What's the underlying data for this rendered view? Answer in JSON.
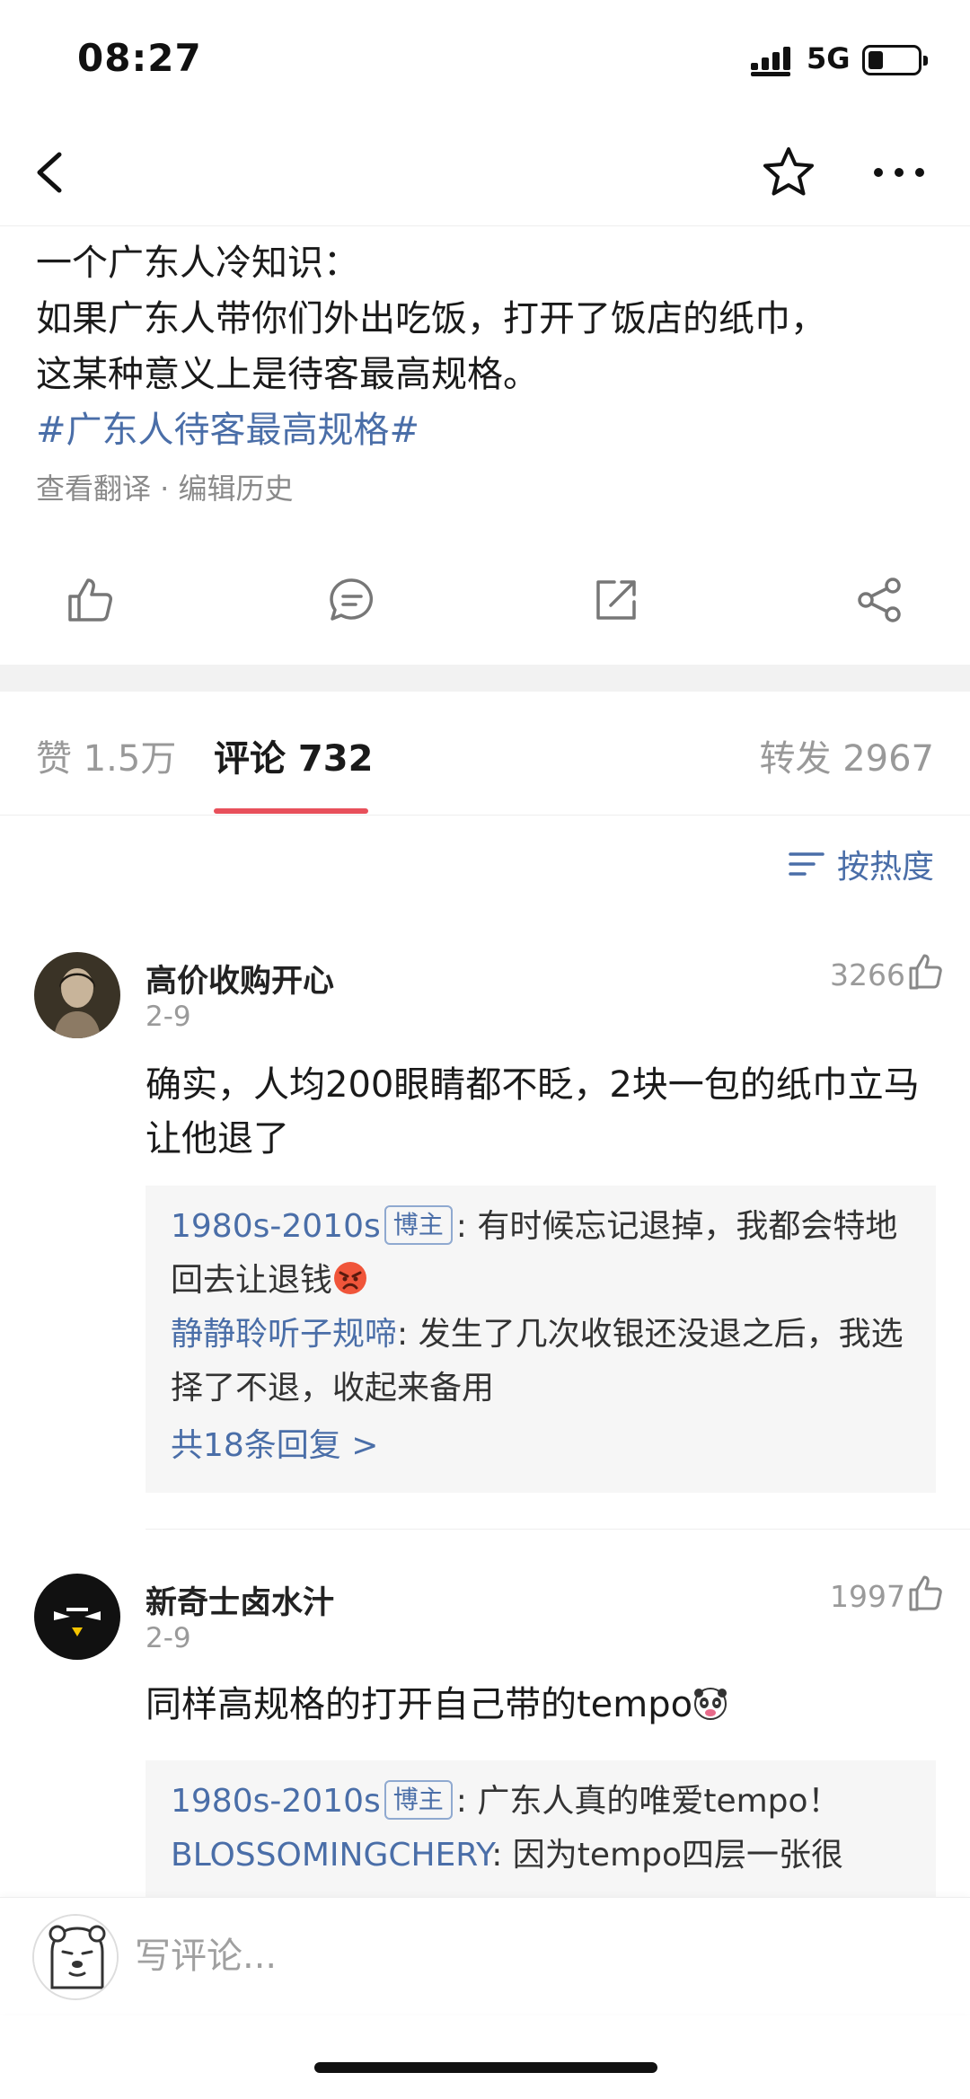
{
  "status": {
    "time": "08:27",
    "network": "5G"
  },
  "post": {
    "lines": [
      "一个广东人冷知识：",
      "如果广东人带你们外出吃饭，打开了饭店的纸巾，",
      "这某种意义上是待客最高规格。"
    ],
    "hashtag": "#广东人待客最高规格#",
    "meta": "查看翻译 · 编辑历史"
  },
  "tabs": {
    "likes": "赞 1.5万",
    "comments": "评论 732",
    "reposts": "转发 2967"
  },
  "sort_label": "按热度",
  "comments": [
    {
      "name": "高价收购开心",
      "date": "2-9",
      "likes": "3266",
      "text": "确实，人均200眼睛都不眨，2块一包的纸巾立马让他退了",
      "replies": [
        {
          "name": "1980s-2010s",
          "badge": "博主",
          "text": ": 有时候忘记退掉，我都会特地回去让退钱"
        },
        {
          "name": "静静聆听子规啼",
          "text": ": 发生了几次收银还没退之后，我选择了不退，收起来备用"
        }
      ],
      "more": "共18条回复 >"
    },
    {
      "name": "新奇士卤水汁",
      "date": "2-9",
      "likes": "1997",
      "text": "同样高规格的打开自己带的tempo",
      "replies": [
        {
          "name": "1980s-2010s",
          "badge": "博主",
          "text": ": 广东人真的唯爱tempo！"
        },
        {
          "name": "BLOSSOMINGCHERY",
          "text": ": 因为tempo四层一张很"
        }
      ]
    }
  ],
  "composer": {
    "placeholder": "写评论..."
  }
}
